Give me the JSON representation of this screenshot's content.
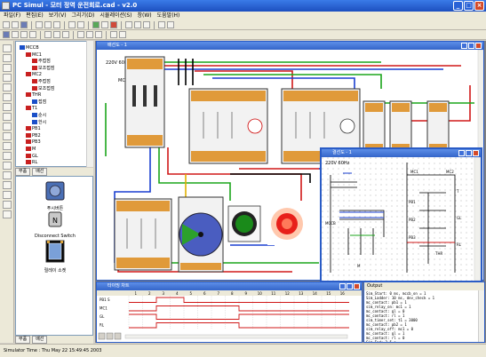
{
  "window": {
    "title": "PC Simul - 모터 정역 운전회로.cad - v2.0",
    "buttons": [
      "minimize",
      "maximize",
      "close"
    ]
  },
  "menu": [
    "파일(F)",
    "편집(E)",
    "보기(V)",
    "그리기(D)",
    "시뮬레이션(S)",
    "창(W)",
    "도움말(H)"
  ],
  "tree": {
    "items": [
      {
        "label": "MCCB",
        "indent": 0,
        "color": "#1a4fc8"
      },
      {
        "label": "MC1",
        "indent": 1,
        "color": "#c82020"
      },
      {
        "label": "주접점",
        "indent": 2,
        "color": "#c82020"
      },
      {
        "label": "보조접점",
        "indent": 2,
        "color": "#c82020"
      },
      {
        "label": "MC2",
        "indent": 1,
        "color": "#c82020"
      },
      {
        "label": "주접점",
        "indent": 2,
        "color": "#c82020"
      },
      {
        "label": "보조접점",
        "indent": 2,
        "color": "#c82020"
      },
      {
        "label": "THR",
        "indent": 1,
        "color": "#c82020"
      },
      {
        "label": "접점",
        "indent": 2,
        "color": "#1a4fc8"
      },
      {
        "label": "T1",
        "indent": 1,
        "color": "#c82020"
      },
      {
        "label": "순시",
        "indent": 2,
        "color": "#1a4fc8"
      },
      {
        "label": "한시",
        "indent": 2,
        "color": "#1a4fc8"
      },
      {
        "label": "PB1",
        "indent": 1,
        "color": "#c82020"
      },
      {
        "label": "PB2",
        "indent": 1,
        "color": "#c82020"
      },
      {
        "label": "PB3",
        "indent": 1,
        "color": "#c82020"
      },
      {
        "label": "M",
        "indent": 1,
        "color": "#c82020"
      },
      {
        "label": "GL",
        "indent": 1,
        "color": "#c82020"
      },
      {
        "label": "RL",
        "indent": 1,
        "color": "#c82020"
      }
    ]
  },
  "left_tabs": [
    "부품",
    "배선"
  ],
  "components": [
    {
      "label": "푸시버튼",
      "kind": "pushbutton"
    },
    {
      "label": "Disconnect Switch",
      "kind": "switch"
    },
    {
      "label": "릴레이 소켓",
      "kind": "socket"
    }
  ],
  "left_tabs2": [
    "부품",
    "배선"
  ],
  "schematic": {
    "title": "배선도 - 1",
    "supply_label": "220V 60Hz",
    "mccb_label": "MCCB"
  },
  "circuit": {
    "title": "결선도 - 1",
    "supply_label": "220V 60Hz",
    "labels": [
      "MCCB",
      "MC1",
      "MC2",
      "THR",
      "PB1",
      "PB2",
      "PB3",
      "T",
      "GL",
      "RL",
      "M"
    ]
  },
  "timing": {
    "title": "타이밍 차트",
    "columns": [
      "1",
      "2",
      "3",
      "4",
      "5",
      "6",
      "7",
      "8",
      "9",
      "10",
      "11",
      "12",
      "13",
      "14",
      "15",
      "16"
    ],
    "signals": [
      {
        "name": "PB1 S",
        "values": [
          0,
          0,
          1,
          1,
          0,
          0,
          0,
          0,
          0,
          0,
          0,
          0,
          0,
          0,
          0,
          0
        ]
      },
      {
        "name": "MC1",
        "values": [
          0,
          0,
          1,
          1,
          1,
          1,
          1,
          1,
          0,
          0,
          0,
          0,
          0,
          0,
          0,
          0
        ]
      },
      {
        "name": "GL",
        "values": [
          1,
          1,
          0,
          0,
          0,
          0,
          0,
          0,
          1,
          1,
          1,
          1,
          1,
          1,
          1,
          1
        ]
      },
      {
        "name": "RL",
        "values": [
          0,
          0,
          1,
          1,
          1,
          1,
          1,
          1,
          0,
          0,
          0,
          0,
          0,
          0,
          0,
          0
        ]
      }
    ]
  },
  "output": {
    "title": "Output",
    "lines": [
      "Sim_Start: 0 ms, mccb_on = 1",
      "Sim_Ladder: 10 ms, dev_check = 1",
      "mc_contact: pb1 = 1",
      "sim_relay_on: mc1 = 1",
      "mc_contact: gl = 0",
      "mc_contact: rl = 1",
      "sim_timer_set: t1 = 3000",
      "mc_contact: pb2 = 1",
      "sim_relay_off: mc1 = 0",
      "mc_contact: gl = 1",
      "mc_contact: rl = 0",
      "Sim_End: 2.5 s"
    ]
  },
  "statusbar": {
    "text": "Simulator Time : Thu May 22 15:49:45 2003"
  }
}
